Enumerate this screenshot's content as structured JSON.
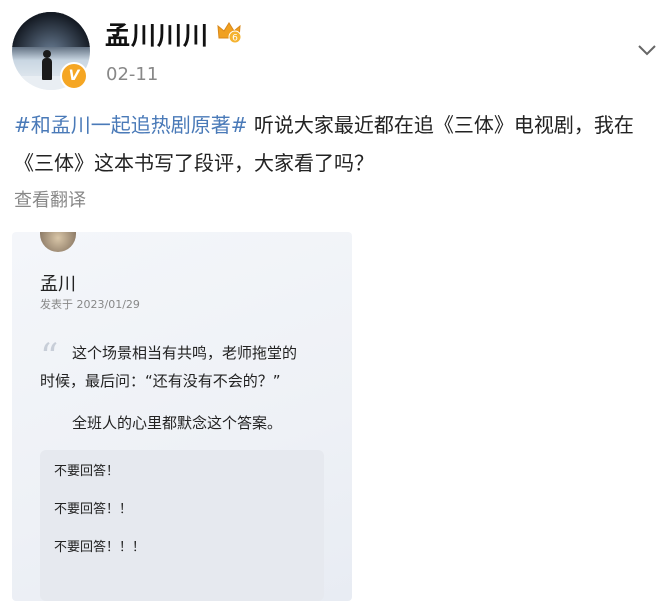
{
  "post": {
    "author": "孟川川川",
    "date": "02-11",
    "hashtag": "#和孟川一起追热剧原著#",
    "text_line1": " 听说大家最近都在追《三体》电视剧，我在",
    "text_line2": "《三体》这本书写了段评，大家看了吗？",
    "translate_label": "查看翻译",
    "level_badge": "6",
    "verified_badge": "V"
  },
  "card": {
    "username": "孟川",
    "meta": "发表于 2023/01/29",
    "quote_line1": "这个场景相当有共鸣，老师拖堂的",
    "quote_line2": "时候，最后问：“还有没有不会的？”",
    "quote_line3": "全班人的心里都默念这个答案。",
    "replies": [
      "不要回答！",
      "不要回答！！",
      "不要回答！！！"
    ]
  },
  "icons": {
    "chevron": "chevron-down-icon",
    "crown": "crown-level-icon",
    "verified": "verified-badge-icon",
    "quote": "quote-mark-icon"
  },
  "colors": {
    "hashtag": "#4a7ab8",
    "verified_badge": "#f5a623",
    "crown": "#f0a020"
  }
}
